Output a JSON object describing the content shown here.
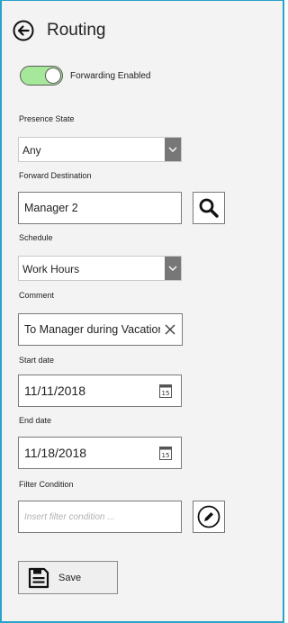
{
  "header": {
    "title": "Routing"
  },
  "forwarding": {
    "label": "Forwarding Enabled",
    "enabled": true
  },
  "presence_state": {
    "label": "Presence State",
    "value": "Any"
  },
  "forward_destination": {
    "label": "Forward Destination",
    "value": "Manager 2"
  },
  "schedule": {
    "label": "Schedule",
    "value": "Work Hours"
  },
  "comment": {
    "label": "Comment",
    "value": "To Manager during Vacation"
  },
  "start_date": {
    "label": "Start date",
    "value": "11/11/2018",
    "calendar_day": "15"
  },
  "end_date": {
    "label": "End date",
    "value": "11/18/2018",
    "calendar_day": "15"
  },
  "filter_condition": {
    "label": "Filter Condition",
    "placeholder": "Insert filter condition ..."
  },
  "save": {
    "label": "Save"
  },
  "colors": {
    "toggle_on": "#a6e89a",
    "frame_border": "#2aa3c9",
    "dropdown_arrow_bg": "#777777"
  }
}
